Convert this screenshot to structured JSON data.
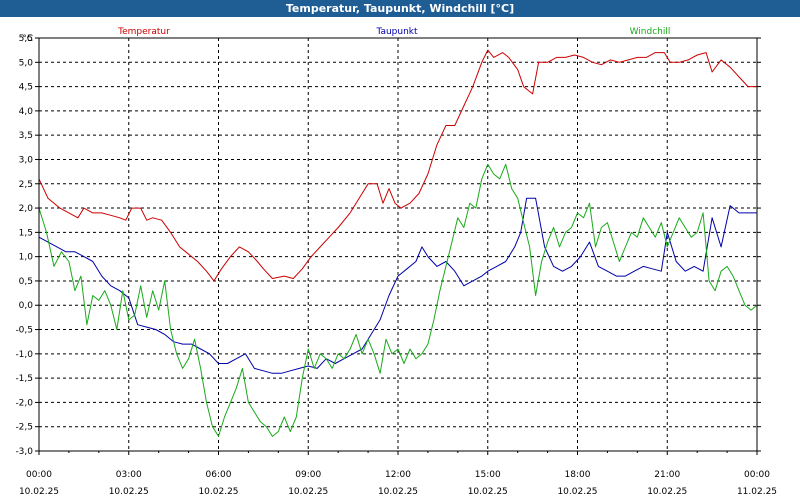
{
  "window": {
    "title": "Temperatur, Taupunkt, Windchill [°C]"
  },
  "chart_data": {
    "type": "line",
    "title": "Temperatur, Taupunkt, Windchill [°C]",
    "y_unit": "°C",
    "ylim": [
      -3.0,
      5.5
    ],
    "y_ticks": [
      "-3,0",
      "-2,5",
      "-2,0",
      "-1,5",
      "-1,0",
      "-0,5",
      "0,0",
      "0,5",
      "1,0",
      "1,5",
      "2,0",
      "2,5",
      "3,0",
      "3,5",
      "4,0",
      "4,5",
      "5,0",
      "5,5"
    ],
    "xlim": [
      0,
      24
    ],
    "x_ticks": [
      {
        "time": "00:00",
        "date": "10.02.25"
      },
      {
        "time": "03:00",
        "date": "10.02.25"
      },
      {
        "time": "06:00",
        "date": "10.02.25"
      },
      {
        "time": "09:00",
        "date": "10.02.25"
      },
      {
        "time": "12:00",
        "date": "10.02.25"
      },
      {
        "time": "15:00",
        "date": "10.02.25"
      },
      {
        "time": "18:00",
        "date": "10.02.25"
      },
      {
        "time": "21:00",
        "date": "10.02.25"
      },
      {
        "time": "00:00",
        "date": "11.02.25"
      }
    ],
    "grid": true,
    "legend_position": "top",
    "series": [
      {
        "name": "Temperatur",
        "color": "#cc0000",
        "points": [
          [
            0,
            2.6
          ],
          [
            0.3,
            2.2
          ],
          [
            0.7,
            2.0
          ],
          [
            1.0,
            1.9
          ],
          [
            1.3,
            1.8
          ],
          [
            1.5,
            2.0
          ],
          [
            1.8,
            1.9
          ],
          [
            2.1,
            1.9
          ],
          [
            2.4,
            1.85
          ],
          [
            2.7,
            1.8
          ],
          [
            2.9,
            1.75
          ],
          [
            3.1,
            2.0
          ],
          [
            3.4,
            2.0
          ],
          [
            3.6,
            1.75
          ],
          [
            3.8,
            1.8
          ],
          [
            4.1,
            1.75
          ],
          [
            4.4,
            1.5
          ],
          [
            4.7,
            1.2
          ],
          [
            5.0,
            1.05
          ],
          [
            5.3,
            0.9
          ],
          [
            5.6,
            0.7
          ],
          [
            5.85,
            0.5
          ],
          [
            6.1,
            0.75
          ],
          [
            6.4,
            1.0
          ],
          [
            6.7,
            1.2
          ],
          [
            7.0,
            1.1
          ],
          [
            7.3,
            0.9
          ],
          [
            7.5,
            0.75
          ],
          [
            7.8,
            0.55
          ],
          [
            8.2,
            0.6
          ],
          [
            8.5,
            0.55
          ],
          [
            8.8,
            0.75
          ],
          [
            9.1,
            1.0
          ],
          [
            9.4,
            1.2
          ],
          [
            9.7,
            1.4
          ],
          [
            10.0,
            1.6
          ],
          [
            10.4,
            1.9
          ],
          [
            10.8,
            2.3
          ],
          [
            11.0,
            2.5
          ],
          [
            11.3,
            2.5
          ],
          [
            11.5,
            2.1
          ],
          [
            11.7,
            2.4
          ],
          [
            11.9,
            2.1
          ],
          [
            12.1,
            2.0
          ],
          [
            12.4,
            2.1
          ],
          [
            12.7,
            2.3
          ],
          [
            13.0,
            2.7
          ],
          [
            13.3,
            3.3
          ],
          [
            13.6,
            3.7
          ],
          [
            13.9,
            3.7
          ],
          [
            14.2,
            4.1
          ],
          [
            14.5,
            4.5
          ],
          [
            14.8,
            5.0
          ],
          [
            15.0,
            5.25
          ],
          [
            15.2,
            5.1
          ],
          [
            15.5,
            5.2
          ],
          [
            15.7,
            5.1
          ],
          [
            16.0,
            4.85
          ],
          [
            16.2,
            4.5
          ],
          [
            16.5,
            4.35
          ],
          [
            16.7,
            5.0
          ],
          [
            17.0,
            5.0
          ],
          [
            17.3,
            5.1
          ],
          [
            17.6,
            5.1
          ],
          [
            17.9,
            5.15
          ],
          [
            18.2,
            5.1
          ],
          [
            18.5,
            5.0
          ],
          [
            18.8,
            4.95
          ],
          [
            19.1,
            5.05
          ],
          [
            19.4,
            5.0
          ],
          [
            19.7,
            5.05
          ],
          [
            20.0,
            5.1
          ],
          [
            20.3,
            5.1
          ],
          [
            20.6,
            5.2
          ],
          [
            20.9,
            5.2
          ],
          [
            21.1,
            5.0
          ],
          [
            21.4,
            5.0
          ],
          [
            21.7,
            5.05
          ],
          [
            22.0,
            5.15
          ],
          [
            22.3,
            5.2
          ],
          [
            22.5,
            4.8
          ],
          [
            22.8,
            5.05
          ],
          [
            23.1,
            4.9
          ],
          [
            23.4,
            4.7
          ],
          [
            23.7,
            4.5
          ],
          [
            24.0,
            4.5
          ]
        ]
      },
      {
        "name": "Taupunkt",
        "color": "#0000aa",
        "points": [
          [
            0,
            1.4
          ],
          [
            0.3,
            1.3
          ],
          [
            0.6,
            1.2
          ],
          [
            0.9,
            1.1
          ],
          [
            1.2,
            1.1
          ],
          [
            1.5,
            1.0
          ],
          [
            1.8,
            0.9
          ],
          [
            2.1,
            0.6
          ],
          [
            2.4,
            0.4
          ],
          [
            2.7,
            0.3
          ],
          [
            3.0,
            0.15
          ],
          [
            3.3,
            -0.4
          ],
          [
            3.6,
            -0.45
          ],
          [
            3.9,
            -0.5
          ],
          [
            4.2,
            -0.6
          ],
          [
            4.5,
            -0.75
          ],
          [
            4.8,
            -0.8
          ],
          [
            5.1,
            -0.8
          ],
          [
            5.4,
            -0.9
          ],
          [
            5.7,
            -1.0
          ],
          [
            6.0,
            -1.2
          ],
          [
            6.3,
            -1.2
          ],
          [
            6.6,
            -1.1
          ],
          [
            6.9,
            -1.0
          ],
          [
            7.2,
            -1.3
          ],
          [
            7.5,
            -1.35
          ],
          [
            7.8,
            -1.4
          ],
          [
            8.1,
            -1.4
          ],
          [
            8.4,
            -1.35
          ],
          [
            8.7,
            -1.3
          ],
          [
            9.0,
            -1.25
          ],
          [
            9.3,
            -1.3
          ],
          [
            9.6,
            -1.1
          ],
          [
            9.9,
            -1.2
          ],
          [
            10.2,
            -1.1
          ],
          [
            10.5,
            -1.0
          ],
          [
            10.8,
            -0.9
          ],
          [
            11.1,
            -0.6
          ],
          [
            11.4,
            -0.3
          ],
          [
            11.7,
            0.2
          ],
          [
            12.0,
            0.6
          ],
          [
            12.3,
            0.75
          ],
          [
            12.6,
            0.9
          ],
          [
            12.8,
            1.2
          ],
          [
            13.0,
            1.0
          ],
          [
            13.3,
            0.8
          ],
          [
            13.6,
            0.9
          ],
          [
            13.9,
            0.7
          ],
          [
            14.2,
            0.4
          ],
          [
            14.5,
            0.5
          ],
          [
            14.8,
            0.6
          ],
          [
            15.0,
            0.7
          ],
          [
            15.3,
            0.8
          ],
          [
            15.6,
            0.9
          ],
          [
            15.9,
            1.2
          ],
          [
            16.1,
            1.5
          ],
          [
            16.3,
            2.2
          ],
          [
            16.6,
            2.2
          ],
          [
            16.9,
            1.2
          ],
          [
            17.2,
            0.8
          ],
          [
            17.5,
            0.7
          ],
          [
            17.8,
            0.8
          ],
          [
            18.1,
            1.0
          ],
          [
            18.4,
            1.3
          ],
          [
            18.7,
            0.8
          ],
          [
            19.0,
            0.7
          ],
          [
            19.3,
            0.6
          ],
          [
            19.6,
            0.6
          ],
          [
            19.9,
            0.7
          ],
          [
            20.2,
            0.8
          ],
          [
            20.5,
            0.75
          ],
          [
            20.8,
            0.7
          ],
          [
            21.0,
            1.5
          ],
          [
            21.3,
            0.9
          ],
          [
            21.6,
            0.7
          ],
          [
            21.9,
            0.8
          ],
          [
            22.2,
            0.7
          ],
          [
            22.5,
            1.8
          ],
          [
            22.8,
            1.2
          ],
          [
            23.1,
            2.05
          ],
          [
            23.4,
            1.9
          ],
          [
            23.7,
            1.9
          ],
          [
            24.0,
            1.9
          ]
        ]
      },
      {
        "name": "Windchill",
        "color": "#1aaa1a",
        "points": [
          [
            0,
            2.0
          ],
          [
            0.25,
            1.5
          ],
          [
            0.5,
            0.8
          ],
          [
            0.75,
            1.1
          ],
          [
            1.0,
            0.9
          ],
          [
            1.2,
            0.3
          ],
          [
            1.4,
            0.6
          ],
          [
            1.6,
            -0.4
          ],
          [
            1.8,
            0.2
          ],
          [
            2.0,
            0.1
          ],
          [
            2.2,
            0.3
          ],
          [
            2.4,
            0.0
          ],
          [
            2.6,
            -0.5
          ],
          [
            2.8,
            0.3
          ],
          [
            3.0,
            -0.3
          ],
          [
            3.2,
            -0.2
          ],
          [
            3.4,
            0.4
          ],
          [
            3.6,
            -0.25
          ],
          [
            3.8,
            0.3
          ],
          [
            4.0,
            -0.1
          ],
          [
            4.2,
            0.5
          ],
          [
            4.4,
            -0.5
          ],
          [
            4.6,
            -1.0
          ],
          [
            4.8,
            -1.3
          ],
          [
            5.0,
            -1.1
          ],
          [
            5.2,
            -0.7
          ],
          [
            5.4,
            -1.3
          ],
          [
            5.6,
            -2.0
          ],
          [
            5.8,
            -2.5
          ],
          [
            6.0,
            -2.7
          ],
          [
            6.2,
            -2.3
          ],
          [
            6.4,
            -2.0
          ],
          [
            6.6,
            -1.7
          ],
          [
            6.8,
            -1.3
          ],
          [
            7.0,
            -2.0
          ],
          [
            7.2,
            -2.2
          ],
          [
            7.4,
            -2.4
          ],
          [
            7.6,
            -2.5
          ],
          [
            7.8,
            -2.7
          ],
          [
            8.0,
            -2.6
          ],
          [
            8.2,
            -2.3
          ],
          [
            8.4,
            -2.6
          ],
          [
            8.6,
            -2.3
          ],
          [
            8.8,
            -1.5
          ],
          [
            9.0,
            -0.9
          ],
          [
            9.2,
            -1.3
          ],
          [
            9.4,
            -1.0
          ],
          [
            9.6,
            -1.1
          ],
          [
            9.8,
            -1.3
          ],
          [
            10.0,
            -1.0
          ],
          [
            10.2,
            -1.1
          ],
          [
            10.4,
            -0.9
          ],
          [
            10.6,
            -0.6
          ],
          [
            10.8,
            -1.0
          ],
          [
            11.0,
            -0.7
          ],
          [
            11.2,
            -1.0
          ],
          [
            11.4,
            -1.4
          ],
          [
            11.6,
            -0.7
          ],
          [
            11.8,
            -1.0
          ],
          [
            12.0,
            -0.9
          ],
          [
            12.2,
            -1.2
          ],
          [
            12.4,
            -0.9
          ],
          [
            12.6,
            -1.1
          ],
          [
            12.8,
            -1.0
          ],
          [
            13.0,
            -0.8
          ],
          [
            13.2,
            -0.3
          ],
          [
            13.4,
            0.3
          ],
          [
            13.6,
            0.8
          ],
          [
            13.8,
            1.3
          ],
          [
            14.0,
            1.8
          ],
          [
            14.2,
            1.6
          ],
          [
            14.4,
            2.1
          ],
          [
            14.6,
            2.0
          ],
          [
            14.8,
            2.6
          ],
          [
            15.0,
            2.9
          ],
          [
            15.2,
            2.7
          ],
          [
            15.4,
            2.6
          ],
          [
            15.6,
            2.9
          ],
          [
            15.8,
            2.4
          ],
          [
            16.0,
            2.2
          ],
          [
            16.2,
            1.7
          ],
          [
            16.4,
            1.2
          ],
          [
            16.6,
            0.2
          ],
          [
            16.8,
            0.9
          ],
          [
            17.0,
            1.3
          ],
          [
            17.2,
            1.6
          ],
          [
            17.4,
            1.2
          ],
          [
            17.6,
            1.5
          ],
          [
            17.8,
            1.6
          ],
          [
            18.0,
            1.9
          ],
          [
            18.2,
            1.8
          ],
          [
            18.4,
            2.1
          ],
          [
            18.6,
            1.2
          ],
          [
            18.8,
            1.6
          ],
          [
            19.0,
            1.7
          ],
          [
            19.2,
            1.3
          ],
          [
            19.4,
            0.9
          ],
          [
            19.6,
            1.2
          ],
          [
            19.8,
            1.5
          ],
          [
            20.0,
            1.4
          ],
          [
            20.2,
            1.8
          ],
          [
            20.4,
            1.6
          ],
          [
            20.6,
            1.4
          ],
          [
            20.8,
            1.7
          ],
          [
            21.0,
            1.2
          ],
          [
            21.2,
            1.5
          ],
          [
            21.4,
            1.8
          ],
          [
            21.6,
            1.6
          ],
          [
            21.8,
            1.4
          ],
          [
            22.0,
            1.5
          ],
          [
            22.2,
            1.9
          ],
          [
            22.4,
            0.5
          ],
          [
            22.6,
            0.3
          ],
          [
            22.8,
            0.7
          ],
          [
            23.0,
            0.8
          ],
          [
            23.2,
            0.6
          ],
          [
            23.4,
            0.3
          ],
          [
            23.6,
            0.0
          ],
          [
            23.8,
            -0.1
          ],
          [
            24.0,
            0.0
          ]
        ]
      }
    ]
  }
}
